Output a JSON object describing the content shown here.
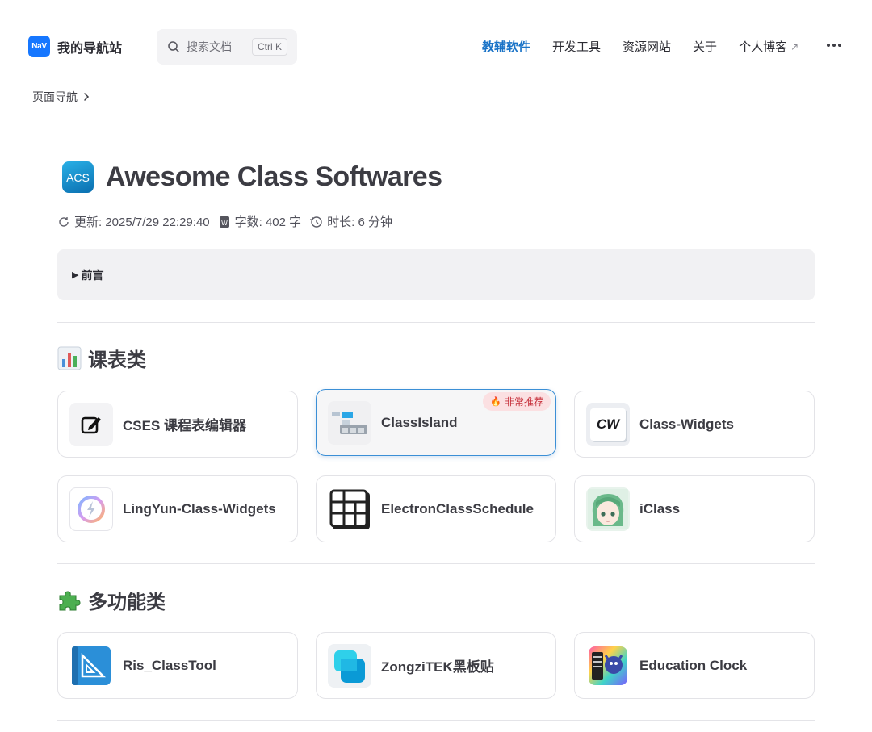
{
  "header": {
    "brand_logo_text": "NaV",
    "brand_title": "我的导航站",
    "search_placeholder": "搜索文档",
    "search_shortcut": "Ctrl K",
    "nav": [
      {
        "label": "教辅软件",
        "active": true
      },
      {
        "label": "开发工具",
        "active": false
      },
      {
        "label": "资源网站",
        "active": false
      },
      {
        "label": "关于",
        "active": false
      },
      {
        "label": "个人博客",
        "active": false,
        "external": true
      }
    ],
    "external_arrow": "↗"
  },
  "breadcrumb": "页面导航",
  "doc": {
    "logo_text": "ACS",
    "title": "Awesome Class Softwares",
    "meta": {
      "updated": "更新: 2025/7/29 22:29:40",
      "words": "字数: 402 字",
      "duration": "时长: 6 分钟"
    },
    "details_summary": "前言",
    "details_marker": "▶"
  },
  "sections": [
    {
      "title": "课表类",
      "icon": "bar-chart-emoji",
      "cards": [
        {
          "name": "CSES 课程表编辑器",
          "icon": "edit-icon"
        },
        {
          "name": "ClassIsland",
          "icon": "classisland-icon",
          "badge": "非常推荐",
          "badge_icon": "🔥",
          "highlight": true
        },
        {
          "name": "Class-Widgets",
          "icon": "class-widgets-icon",
          "icon_text": "CW"
        },
        {
          "name": "LingYun-Class-Widgets",
          "icon": "lingyun-icon"
        },
        {
          "name": "ElectronClassSchedule",
          "icon": "schedule-grid-icon"
        },
        {
          "name": "iClass",
          "icon": "iclass-avatar-icon"
        }
      ]
    },
    {
      "title": "多功能类",
      "icon": "puzzle-emoji",
      "cards": [
        {
          "name": "Ris_ClassTool",
          "icon": "ris-classtool-icon"
        },
        {
          "name": "ZongziTEK黑板贴",
          "icon": "zongzitek-icon"
        },
        {
          "name": "Education Clock",
          "icon": "education-clock-icon"
        }
      ]
    }
  ],
  "colors": {
    "accent": "#1a73c7",
    "highlight_border": "#3b8fd6",
    "badge_bg": "#fbe0e2",
    "badge_text": "#c62f3a"
  }
}
